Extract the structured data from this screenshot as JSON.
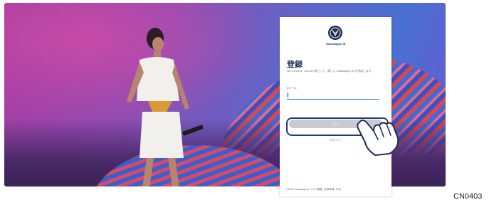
{
  "login_card": {
    "brand": "Volkswagen ID",
    "title": "登録",
    "description": "We Connect / Car-Net 用として、新しい Volkswagen ID を作成します。",
    "email_label": "Eメール",
    "email_value": "",
    "next_button": "次へ",
    "login_link": "ログイン",
    "footer": "© 2019 Volkswagen | ヘルプ情報 | 法律事項 | FAQ"
  },
  "figure_code": "CN0403",
  "icons": {
    "logo": "vw-logo-icon",
    "hand": "pointing-hand-icon"
  },
  "colors": {
    "brand_navy": "#1f2d55",
    "accent_blue": "#3b82c4",
    "button_gray": "#c8ccd2"
  }
}
